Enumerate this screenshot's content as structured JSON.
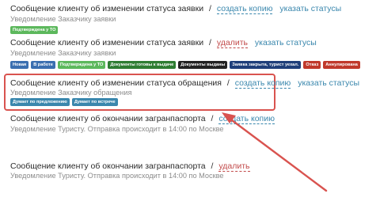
{
  "colors": {
    "link": "#3a87ad",
    "delete_link": "#c24a4a",
    "highlight": "#d9534f"
  },
  "rows": [
    {
      "title": "Сообщение клиенту об изменении статуса заявки",
      "action": "создать копию",
      "action_kind": "add",
      "statuses_link": "указать статусы",
      "subtitle": "Уведомление Заказчику заявки",
      "badges": [
        {
          "label": "Подтверждена у ТО",
          "color": "#5cb85c"
        }
      ]
    },
    {
      "title": "Сообщение клиенту об изменении статуса заявки",
      "action": "удалить",
      "action_kind": "delete",
      "statuses_link": "указать статусы",
      "subtitle": "Уведомление Заказчику заявки",
      "badges": [
        {
          "label": "Новая",
          "color": "#3a6fb0"
        },
        {
          "label": "В работе",
          "color": "#3a6fb0"
        },
        {
          "label": "Подтверждена у ТО",
          "color": "#5cb85c"
        },
        {
          "label": "Документы готовы к выдаче",
          "color": "#2e7d32"
        },
        {
          "label": "Документы выданы",
          "color": "#222222"
        },
        {
          "label": "Заявка закрыта, турист уехал.",
          "color": "#1f3f7a"
        },
        {
          "label": "Отказ",
          "color": "#c0392b"
        },
        {
          "label": "Аннулирована",
          "color": "#c0392b"
        }
      ]
    },
    {
      "title": "Сообщение клиенту об изменении статуса обращения",
      "action": "создать копию",
      "action_kind": "add",
      "statuses_link": "указать статусы",
      "subtitle": "Уведомление Заказчику обращения",
      "badges": [
        {
          "label": "Думает по предложению",
          "color": "#3a87ad"
        },
        {
          "label": "Думает по встрече",
          "color": "#3a87ad"
        }
      ]
    },
    {
      "title": "Сообщение клиенту об окончании загранпаспорта",
      "action": "создать копию",
      "action_kind": "add",
      "statuses_link": "",
      "subtitle": "Уведомление Туристу. Отправка происходит в 14:00 по Москве",
      "badges": []
    },
    {
      "title": "Сообщение клиенту об окончании загранпаспорта",
      "action": "удалить",
      "action_kind": "delete",
      "statuses_link": "",
      "subtitle": "Уведомление Туристу. Отправка происходит в 14:00 по Москве",
      "badges": []
    }
  ]
}
